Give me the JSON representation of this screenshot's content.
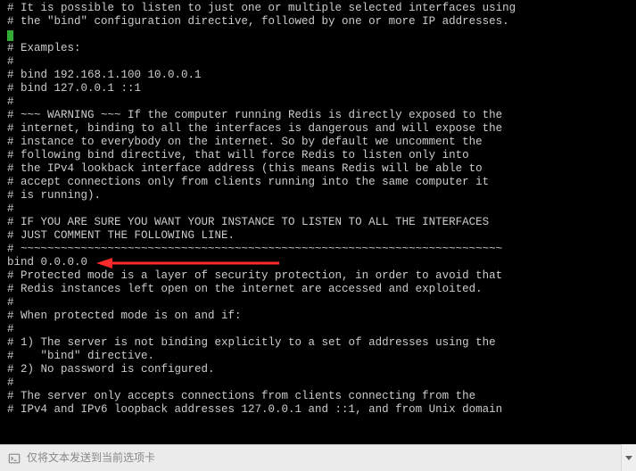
{
  "terminal": {
    "lines": [
      "# It is possible to listen to just one or multiple selected interfaces using",
      "# the \"bind\" configuration directive, followed by one or more IP addresses.",
      "#",
      "# Examples:",
      "#",
      "# bind 192.168.1.100 10.0.0.1",
      "# bind 127.0.0.1 ::1",
      "#",
      "# ~~~ WARNING ~~~ If the computer running Redis is directly exposed to the",
      "# internet, binding to all the interfaces is dangerous and will expose the",
      "# instance to everybody on the internet. So by default we uncomment the",
      "# following bind directive, that will force Redis to listen only into",
      "# the IPv4 lookback interface address (this means Redis will be able to",
      "# accept connections only from clients running into the same computer it",
      "# is running).",
      "#",
      "# IF YOU ARE SURE YOU WANT YOUR INSTANCE TO LISTEN TO ALL THE INTERFACES",
      "# JUST COMMENT THE FOLLOWING LINE.",
      "# ~~~~~~~~~~~~~~~~~~~~~~~~~~~~~~~~~~~~~~~~~~~~~~~~~~~~~~~~~~~~~~~~~~~~~~~~",
      "bind 0.0.0.0",
      "",
      "# Protected mode is a layer of security protection, in order to avoid that",
      "# Redis instances left open on the internet are accessed and exploited.",
      "#",
      "# When protected mode is on and if:",
      "#",
      "# 1) The server is not binding explicitly to a set of addresses using the",
      "#    \"bind\" directive.",
      "# 2) No password is configured.",
      "#",
      "# The server only accepts connections from clients connecting from the",
      "# IPv4 and IPv6 loopback addresses 127.0.0.1 and ::1, and from Unix domain"
    ],
    "cursor_line_index": 2
  },
  "annotation": {
    "arrow_points_to_line_index": 19,
    "arrow_color": "#ff2a2a"
  },
  "statusbar": {
    "text": "仅将文本发送到当前选项卡"
  }
}
